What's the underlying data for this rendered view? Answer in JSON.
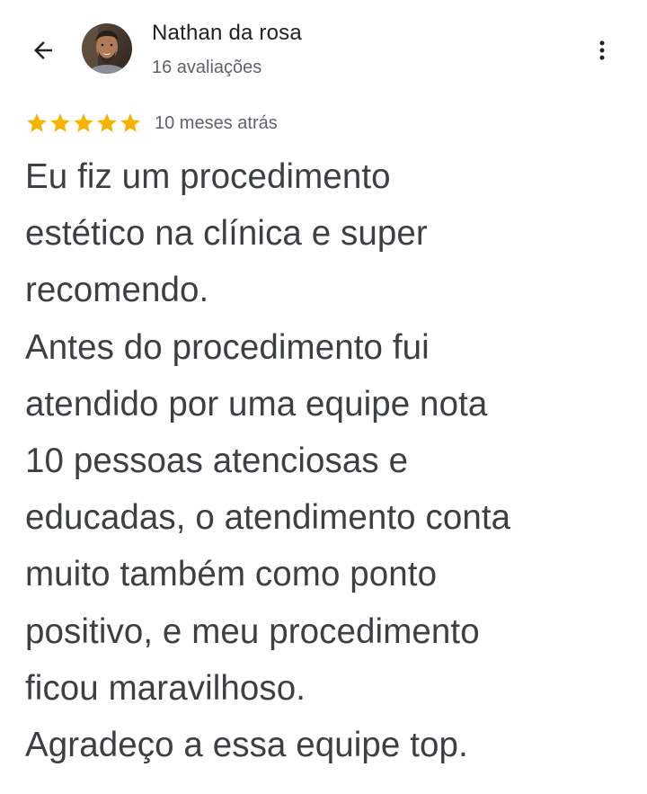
{
  "header": {
    "back_icon": "arrow-back-icon",
    "author_name": "Nathan da rosa",
    "review_count": "16 avaliações",
    "more_icon": "more-vert-icon"
  },
  "rating": {
    "stars": 5,
    "max_stars": 5,
    "star_icon": "star-icon",
    "star_color": "#f4b400",
    "time_ago": "10 meses atrás"
  },
  "review": {
    "lines": [
      "Eu fiz um procedimento",
      "estético na clínica e super",
      "recomendo.",
      "Antes do procedimento fui",
      "atendido por uma equipe nota",
      "10 pessoas  atenciosas e",
      "educadas, o atendimento conta",
      "muito também como ponto",
      "positivo, e meu procedimento",
      "ficou maravilhoso.",
      "Agradeço a essa equipe top."
    ]
  }
}
